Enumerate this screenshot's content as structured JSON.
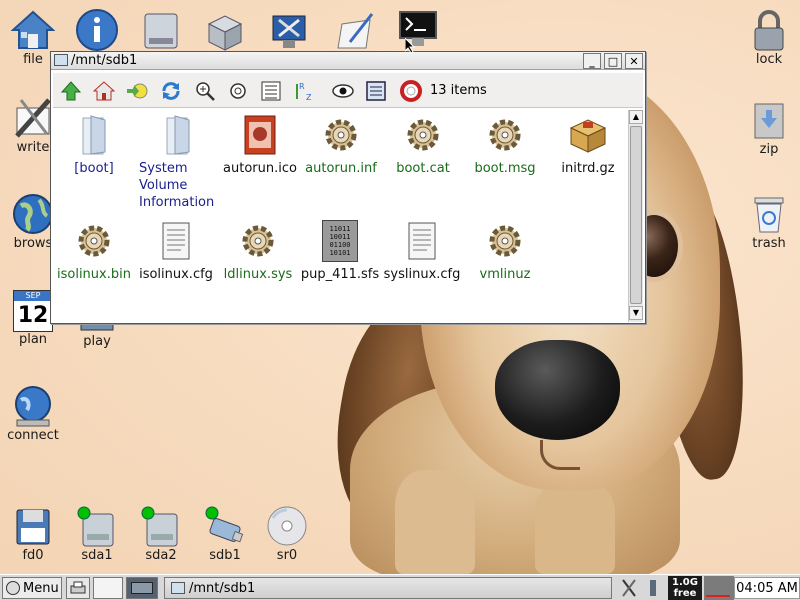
{
  "desktop": {
    "icons": [
      {
        "label": "file"
      },
      {
        "label": "write"
      },
      {
        "label": "brows"
      },
      {
        "label": "plan"
      },
      {
        "label": "play"
      },
      {
        "label": "connect"
      },
      {
        "label": "lock"
      },
      {
        "label": "zip"
      },
      {
        "label": "trash"
      },
      {
        "label": "fd0"
      },
      {
        "label": "sda1"
      },
      {
        "label": "sda2"
      },
      {
        "label": "sdb1"
      },
      {
        "label": "sr0"
      }
    ],
    "calendar": {
      "month": "SEP",
      "day": "12"
    }
  },
  "window": {
    "title": "/mnt/sdb1",
    "minimize": "_",
    "maximize": "□",
    "close": "✕",
    "item_count": "13 items",
    "files": [
      {
        "name": "[boot]",
        "type": "folder"
      },
      {
        "name": "System Volume Information",
        "type": "folder"
      },
      {
        "name": "autorun.ico",
        "type": "image"
      },
      {
        "name": "autorun.inf",
        "type": "exec"
      },
      {
        "name": "boot.cat",
        "type": "exec"
      },
      {
        "name": "boot.msg",
        "type": "exec"
      },
      {
        "name": "initrd.gz",
        "type": "archive"
      },
      {
        "name": "isolinux.bin",
        "type": "exec"
      },
      {
        "name": "isolinux.cfg",
        "type": "text"
      },
      {
        "name": "ldlinux.sys",
        "type": "exec"
      },
      {
        "name": "pup_411.sfs",
        "type": "binary"
      },
      {
        "name": "syslinux.cfg",
        "type": "text"
      },
      {
        "name": "vmlinuz",
        "type": "exec"
      }
    ],
    "binary_glyph": "11011\n10011\n01100\n10101"
  },
  "taskbar": {
    "menu": "Menu",
    "task_title": "/mnt/sdb1",
    "mem_top": "1.0G",
    "mem_bottom": "free",
    "clock": "04:05 AM"
  },
  "colors": {
    "folder_label": "#1b1f8a",
    "exec_label": "#1a6b1a",
    "drive_indicator": "#00c000"
  }
}
